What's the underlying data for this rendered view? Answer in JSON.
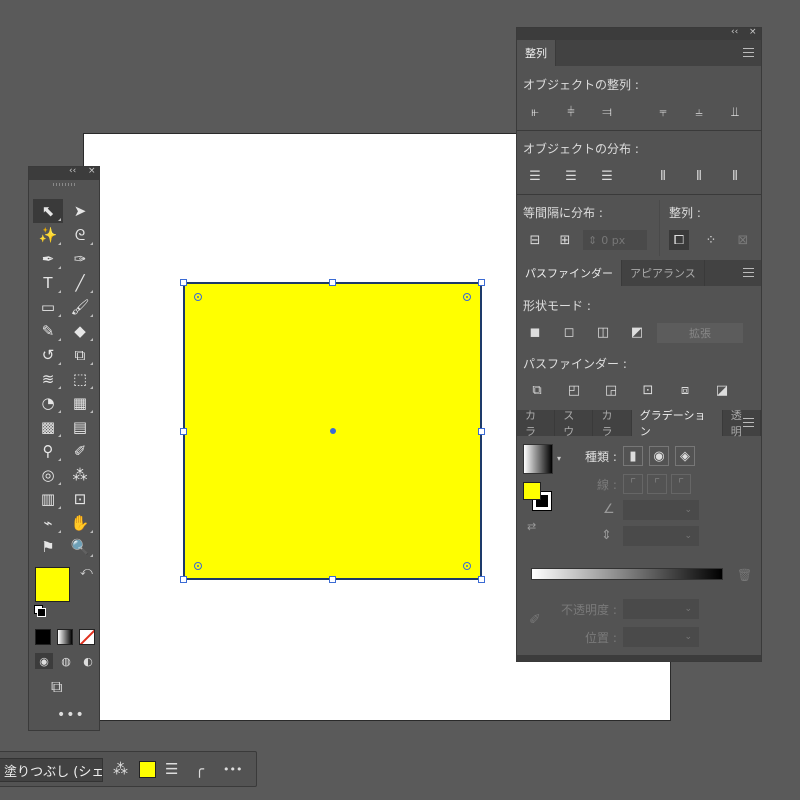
{
  "canvas": {
    "fill_color": "#ffff00",
    "stroke_color": "#1d3a6a",
    "background": "#5a5a5a"
  },
  "tools_panel": {
    "collapse_glyph": "‹‹",
    "close_glyph": "×",
    "tools": [
      {
        "name": "selection-tool",
        "glyph": "⬉"
      },
      {
        "name": "direct-selection-tool",
        "glyph": "➤"
      },
      {
        "name": "magic-wand-tool",
        "glyph": "✨"
      },
      {
        "name": "lasso-tool",
        "glyph": "ᘓ"
      },
      {
        "name": "pen-tool",
        "glyph": "✒"
      },
      {
        "name": "curvature-tool",
        "glyph": "✑"
      },
      {
        "name": "type-tool",
        "glyph": "T"
      },
      {
        "name": "line-segment-tool",
        "glyph": "╱"
      },
      {
        "name": "rectangle-tool",
        "glyph": "▭"
      },
      {
        "name": "paintbrush-tool",
        "glyph": "🖌"
      },
      {
        "name": "shaper-tool",
        "glyph": "✎"
      },
      {
        "name": "eraser-tool",
        "glyph": "◆"
      },
      {
        "name": "rotate-tool",
        "glyph": "↺"
      },
      {
        "name": "scale-tool",
        "glyph": "⧉"
      },
      {
        "name": "width-tool",
        "glyph": "≋"
      },
      {
        "name": "free-transform-tool",
        "glyph": "⬚"
      },
      {
        "name": "shape-builder-tool",
        "glyph": "◔"
      },
      {
        "name": "perspective-grid-tool",
        "glyph": "▦"
      },
      {
        "name": "mesh-tool",
        "glyph": "▩"
      },
      {
        "name": "gradient-tool",
        "glyph": "▤"
      },
      {
        "name": "eyedropper-tool",
        "glyph": "⚲"
      },
      {
        "name": "eyedropper-alt-tool",
        "glyph": "✐"
      },
      {
        "name": "blend-tool",
        "glyph": "◎"
      },
      {
        "name": "symbol-sprayer-tool",
        "glyph": "⁂"
      },
      {
        "name": "column-graph-tool",
        "glyph": "▥"
      },
      {
        "name": "artboard-tool",
        "glyph": "⊡"
      },
      {
        "name": "slice-tool",
        "glyph": "⌁"
      },
      {
        "name": "hand-tool",
        "glyph": "✋"
      },
      {
        "name": "puppet-warp-tool",
        "glyph": "⚑"
      },
      {
        "name": "zoom-tool",
        "glyph": "🔍"
      }
    ],
    "swap_glyph": "⤺",
    "draw_modes": [
      "◉",
      "◍",
      "◐"
    ],
    "screen_mode_glyph": "⧉",
    "more_glyph": "•••"
  },
  "align_panel": {
    "collapse_glyph": "‹‹",
    "close_glyph": "×",
    "tab_label": "整列",
    "align_objects_label": "オブジェクトの整列 :",
    "distribute_objects_label": "オブジェクトの分布 :",
    "distribute_spacing_label": "等間隔に分布 :",
    "align_to_label": "整列 :",
    "spacing_value": "0 px",
    "align_icons": [
      "⫦",
      "⫩",
      "⫤",
      "⫧",
      "⫨",
      "⫫"
    ],
    "distribute_icons": [
      "☰",
      "☰",
      "☰",
      "⦀",
      "⦀",
      "⦀"
    ],
    "spacing_icons": [
      "⊟",
      "⊞"
    ],
    "align_to_icons": [
      "⧠",
      "⁘",
      "⊠"
    ]
  },
  "pathfinder_panel": {
    "tabs": [
      "パスファインダー",
      "アピアランス"
    ],
    "shape_modes_label": "形状モード :",
    "expand_label": "拡張",
    "pathfinders_label": "パスファインダー :",
    "shape_mode_icons": [
      "◼",
      "◻",
      "◫",
      "◩"
    ],
    "pathfinder_icons": [
      "⧉",
      "◰",
      "◲",
      "⊡",
      "⧈",
      "◪"
    ]
  },
  "gradient_panel": {
    "tabs": [
      "カラ",
      "スウ",
      "カラ",
      "グラデーション",
      "透明"
    ],
    "type_label": "種類 :",
    "stroke_label": "線 :",
    "opacity_label": "不透明度 :",
    "location_label": "位置 :",
    "type_icons": [
      "▮",
      "◉",
      "◈"
    ],
    "stroke_icons": [
      "⌜",
      "⌜",
      "⌜"
    ]
  },
  "control_bar": {
    "shape_name": "塗りつぶし (シェイプ)",
    "recolor_glyph": "⁂",
    "stroke_weight_glyph": "☰",
    "corner_glyph": "╭",
    "more_glyph": "•••"
  }
}
